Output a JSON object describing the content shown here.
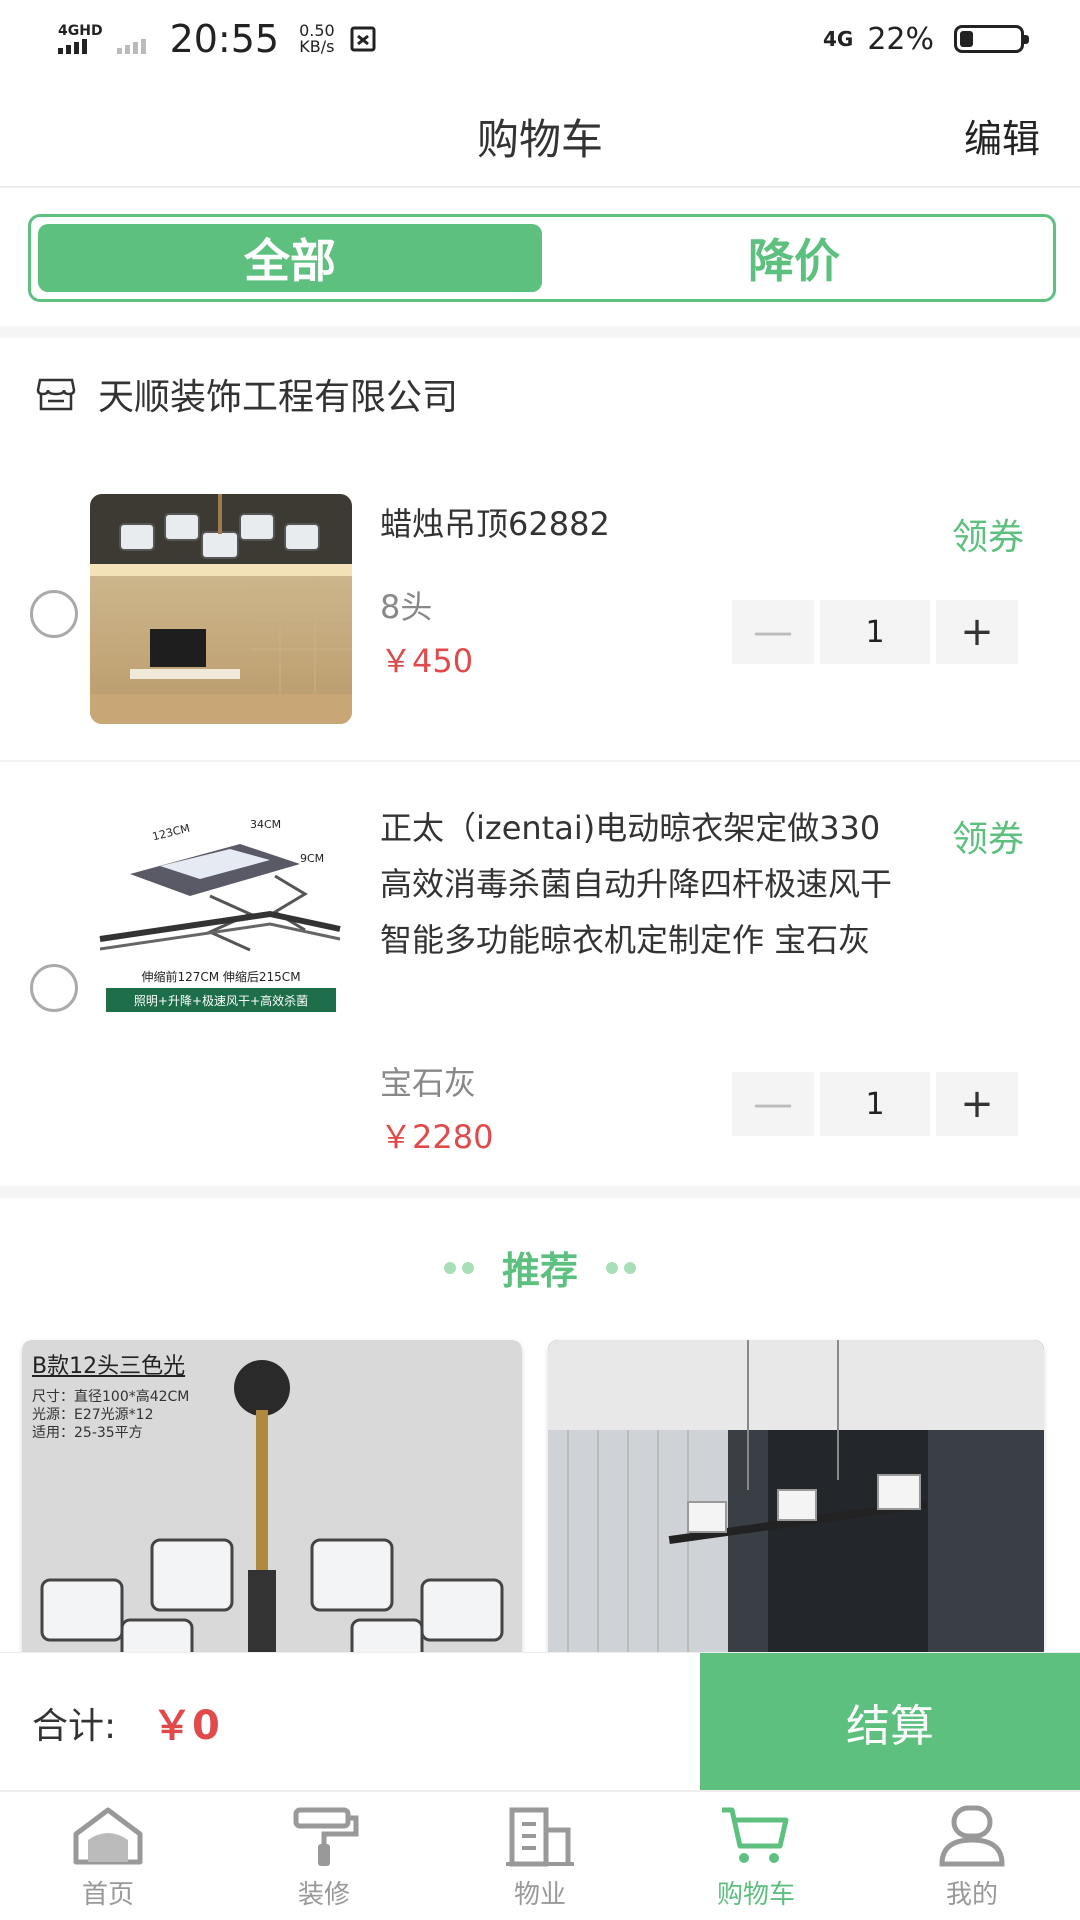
{
  "status_bar": {
    "network": "4GHD",
    "time": "20:55",
    "speed_value": "0.50",
    "speed_unit": "KB/s",
    "network_right": "4G",
    "battery": "22%",
    "battery_level": 0.22
  },
  "header": {
    "title": "购物车",
    "edit_label": "编辑"
  },
  "tabs": [
    {
      "label": "全部",
      "active": true
    },
    {
      "label": "降价",
      "active": false
    }
  ],
  "shop": {
    "icon": "store-icon",
    "name": "天顺装饰工程有限公司"
  },
  "items": [
    {
      "title": "蜡烛吊顶62882",
      "coupon_label": "领券",
      "variant": "8头",
      "price": "￥450",
      "quantity": "1",
      "checked": false
    },
    {
      "title": "正太（izentai)电动晾衣架定做330高效消毒杀菌自动升降四杆极速风干智能多功能晾衣机定制定作 宝石灰",
      "coupon_label": "领券",
      "variant": "宝石灰",
      "price": "￥2280",
      "quantity": "1",
      "checked": false,
      "image_text": {
        "dim1": "123CM",
        "dim2": "34CM",
        "dim3": "9CM",
        "caption": "伸缩前127CM 伸缩后215CM",
        "banner": "照明+升降+极速风干+高效杀菌"
      }
    }
  ],
  "stepper": {
    "minus": "—",
    "plus": "+"
  },
  "recommend": {
    "label": "推荐",
    "cards": [
      {
        "caption": "B款12头三色光",
        "spec_lines": [
          "尺寸：直径100*高42CM",
          "光源：E27光源*12",
          "适用：25-35平方"
        ]
      },
      {
        "caption": ""
      }
    ]
  },
  "checkout": {
    "total_label": "合计:",
    "total_value": "￥0",
    "button_label": "结算"
  },
  "nav": [
    {
      "label": "首页",
      "icon": "home-icon",
      "active": false
    },
    {
      "label": "装修",
      "icon": "paint-roller-icon",
      "active": false
    },
    {
      "label": "物业",
      "icon": "building-icon",
      "active": false
    },
    {
      "label": "购物车",
      "icon": "cart-icon",
      "active": true
    },
    {
      "label": "我的",
      "icon": "user-icon",
      "active": false
    }
  ],
  "colors": {
    "accent": "#5dc07f",
    "price": "#e04a4a"
  }
}
